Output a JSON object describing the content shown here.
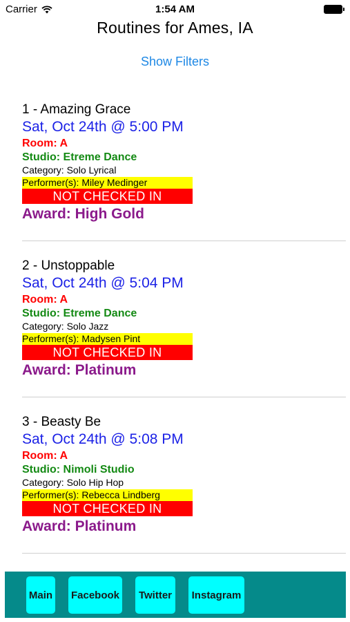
{
  "status_bar": {
    "carrier": "Carrier",
    "time": "1:54 AM",
    "wifi_icon": "wifi-icon",
    "battery_icon": "battery-icon"
  },
  "header": {
    "title": "Routines for Ames, IA",
    "filters_link": "Show Filters"
  },
  "routines": [
    {
      "title": "1 - Amazing Grace",
      "datetime": "Sat, Oct 24th @ 5:00 PM",
      "room": "Room: A",
      "studio": "Studio: Etreme Dance",
      "category": "Category: Solo Lyrical",
      "performers": "Performer(s): Miley Medinger",
      "status": "NOT CHECKED IN",
      "award": "Award: High Gold"
    },
    {
      "title": "2 - Unstoppable",
      "datetime": "Sat, Oct 24th @ 5:04 PM",
      "room": "Room: A",
      "studio": "Studio: Etreme Dance",
      "category": "Category: Solo Jazz",
      "performers": "Performer(s): Madysen Pint",
      "status": "NOT CHECKED IN",
      "award": "Award: Platinum"
    },
    {
      "title": "3 - Beasty Be",
      "datetime": "Sat, Oct 24th @ 5:08 PM",
      "room": "Room: A",
      "studio": "Studio: Nimoli Studio",
      "category": "Category: Solo Hip Hop",
      "performers": "Performer(s): Rebecca Lindberg",
      "status": "NOT CHECKED IN",
      "award": "Award: Platinum"
    }
  ],
  "bottom_nav": {
    "main": "Main",
    "facebook": "Facebook",
    "twitter": "Twitter",
    "instagram": "Instagram"
  },
  "colors": {
    "link": "#1e88e5",
    "datetime": "#1c22e6",
    "room": "#ff0000",
    "studio": "#148a14",
    "performer_highlight": "#ffff00",
    "status_bg": "#ff0000",
    "award": "#8b1a8b",
    "bottom_bar": "#058a8a",
    "nav_button": "#00ffff"
  }
}
